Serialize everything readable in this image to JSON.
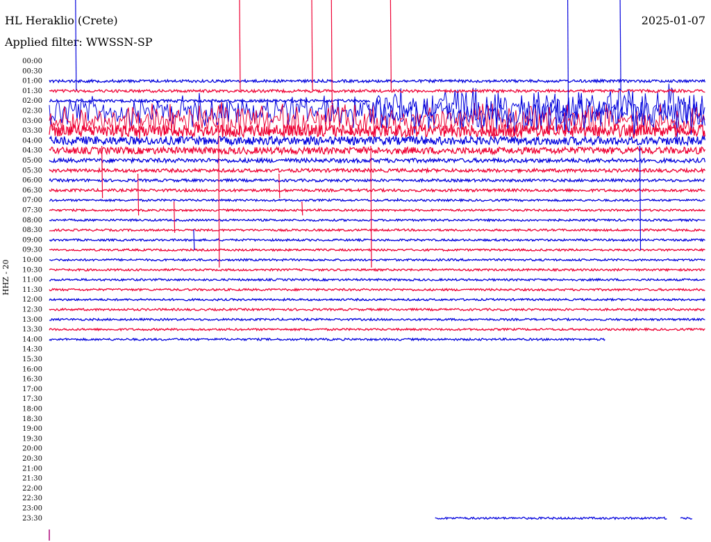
{
  "header": {
    "station": "HL Heraklio (Crete)",
    "date": "2025-01-07",
    "filter_label": "Applied filter: WWSSN-SP"
  },
  "chart_data": {
    "type": "line",
    "title": "HL Heraklio (Crete)",
    "ylabel": "HHZ - 20",
    "y_tick_labels": [
      "00:00",
      "00:30",
      "01:00",
      "01:30",
      "02:00",
      "02:30",
      "03:00",
      "03:30",
      "04:00",
      "04:30",
      "05:00",
      "05:30",
      "06:00",
      "06:30",
      "07:00",
      "07:30",
      "08:00",
      "08:30",
      "09:00",
      "09:30",
      "10:00",
      "10:30",
      "11:00",
      "11:30",
      "12:00",
      "12:30",
      "13:00",
      "13:30",
      "14:00",
      "14:30",
      "15:30",
      "16:00",
      "16:30",
      "17:00",
      "17:30",
      "18:00",
      "18:30",
      "19:00",
      "19:30",
      "20:00",
      "20:30",
      "21:00",
      "21:30",
      "22:00",
      "22:30",
      "23:00",
      "23:30"
    ],
    "x_range_fraction": [
      0,
      1
    ],
    "series_colors": [
      "#0000dd",
      "#ee0033"
    ],
    "traces": [
      {
        "label": "01:00",
        "amp": 2,
        "color": "blue",
        "end": 1,
        "start": 0
      },
      {
        "label": "01:30",
        "amp": 2,
        "color": "red",
        "end": 1,
        "start": 0
      },
      {
        "label": "02:00",
        "amp": 2,
        "color": "blue",
        "end": 0.49,
        "start": 0
      },
      {
        "label": "03:30",
        "amp": 9,
        "color": "red",
        "end": 1,
        "start": 0
      },
      {
        "label": "04:00",
        "amp": 6,
        "color": "blue",
        "end": 1,
        "start": 0
      },
      {
        "label": "04:30",
        "amp": 5,
        "color": "red",
        "end": 1,
        "start": 0
      },
      {
        "label": "05:00",
        "amp": 3,
        "color": "blue",
        "end": 1,
        "start": 0
      },
      {
        "label": "05:30",
        "amp": 2.5,
        "color": "red",
        "end": 1,
        "start": 0
      },
      {
        "label": "06:00",
        "amp": 2,
        "color": "blue",
        "end": 1,
        "start": 0
      },
      {
        "label": "06:30",
        "amp": 2,
        "color": "red",
        "end": 1,
        "start": 0
      },
      {
        "label": "07:00",
        "amp": 1.5,
        "color": "blue",
        "end": 1,
        "start": 0
      },
      {
        "label": "07:30",
        "amp": 1.5,
        "color": "red",
        "end": 1,
        "start": 0
      },
      {
        "label": "08:00",
        "amp": 1.5,
        "color": "blue",
        "end": 1,
        "start": 0
      },
      {
        "label": "08:30",
        "amp": 1.5,
        "color": "red",
        "end": 1,
        "start": 0
      },
      {
        "label": "09:00",
        "amp": 1.5,
        "color": "blue",
        "end": 1,
        "start": 0
      },
      {
        "label": "09:30",
        "amp": 1.5,
        "color": "red",
        "end": 1,
        "start": 0
      },
      {
        "label": "10:00",
        "amp": 1.5,
        "color": "blue",
        "end": 1,
        "start": 0
      },
      {
        "label": "10:30",
        "amp": 1.5,
        "color": "red",
        "end": 1,
        "start": 0
      },
      {
        "label": "11:00",
        "amp": 1.5,
        "color": "blue",
        "end": 1,
        "start": 0
      },
      {
        "label": "11:30",
        "amp": 1.5,
        "color": "red",
        "end": 1,
        "start": 0
      },
      {
        "label": "12:00",
        "amp": 1.5,
        "color": "blue",
        "end": 1,
        "start": 0
      },
      {
        "label": "12:30",
        "amp": 1.5,
        "color": "red",
        "end": 1,
        "start": 0
      },
      {
        "label": "13:00",
        "amp": 1.5,
        "color": "blue",
        "end": 1,
        "start": 0
      },
      {
        "label": "13:30",
        "amp": 1.5,
        "color": "red",
        "end": 1,
        "start": 0
      },
      {
        "label": "14:00",
        "amp": 1.5,
        "color": "blue",
        "end": 0.847,
        "start": 0
      },
      {
        "label": "23:30",
        "amp": 1.5,
        "color": "blue",
        "end": 0.942,
        "start": 0.588
      },
      {
        "label": "23:30b",
        "amp": 1.5,
        "color": "blue",
        "end": 0.98,
        "start": 0.962
      }
    ],
    "burst_traces": [
      {
        "label": "02:30",
        "amp": 28,
        "color": "blue",
        "start": 0,
        "end": 1
      },
      {
        "label": "03:00",
        "amp": 30,
        "color": "red",
        "start": 0,
        "end": 1
      },
      {
        "label": "02:30b",
        "amp": 40,
        "color": "blue",
        "start": 0.485,
        "end": 1
      }
    ],
    "spikes": [
      {
        "x": 0.04,
        "color": "blue",
        "up": 9999
      },
      {
        "x": 0.08,
        "color": "red",
        "down": 9999
      },
      {
        "x": 0.135,
        "color": "red",
        "down": 9999
      },
      {
        "x": 0.19,
        "color": "red",
        "down": 9999
      },
      {
        "x": 0.22,
        "color": "blue",
        "down": 9999
      },
      {
        "x": 0.258,
        "color": "red",
        "down": 9999
      },
      {
        "x": 0.29,
        "color": "red",
        "up": 9999
      },
      {
        "x": 0.35,
        "color": "red",
        "down": 9999
      },
      {
        "x": 0.385,
        "color": "red",
        "down": 9999
      },
      {
        "x": 0.4,
        "color": "red",
        "up": 9999
      },
      {
        "x": 0.43,
        "color": "red",
        "up": 9999
      },
      {
        "x": 0.49,
        "color": "red",
        "down": 9999
      },
      {
        "x": 0.52,
        "color": "red",
        "up": 9999
      },
      {
        "x": 0.53,
        "color": "blue",
        "down": 9999
      },
      {
        "x": 0.79,
        "color": "blue",
        "up": 9999
      },
      {
        "x": 0.87,
        "color": "blue",
        "up": 9999
      },
      {
        "x": 0.9,
        "color": "blue",
        "down": 9999
      }
    ]
  }
}
